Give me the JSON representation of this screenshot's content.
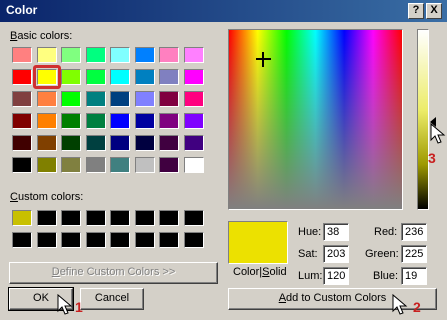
{
  "window": {
    "title": "Color",
    "help_label": "?",
    "close_label": "X"
  },
  "basic_colors": {
    "label_prefix": "B",
    "label_rest": "asic colors:",
    "rows": [
      [
        "#ff8080",
        "#ffff80",
        "#80ff80",
        "#00ff80",
        "#80ffff",
        "#0080ff",
        "#ff80c0",
        "#ff80ff"
      ],
      [
        "#ff0000",
        "#ffff00",
        "#80ff00",
        "#00ff40",
        "#00ffff",
        "#0080c0",
        "#8080c0",
        "#ff00ff"
      ],
      [
        "#804040",
        "#ff8040",
        "#00ff00",
        "#008080",
        "#004080",
        "#8080ff",
        "#800040",
        "#ff0080"
      ],
      [
        "#800000",
        "#ff8000",
        "#008000",
        "#008040",
        "#0000ff",
        "#0000a0",
        "#800080",
        "#8000ff"
      ],
      [
        "#400000",
        "#804000",
        "#004000",
        "#004040",
        "#000080",
        "#000040",
        "#400040",
        "#400080"
      ],
      [
        "#000000",
        "#808000",
        "#808040",
        "#808080",
        "#408080",
        "#c0c0c0",
        "#400040",
        "#ffffff"
      ]
    ],
    "selected": [
      1,
      1
    ]
  },
  "custom_colors": {
    "label_prefix": "C",
    "label_rest": "ustom colors:",
    "rows": [
      [
        "#c8c000",
        "#000000",
        "#000000",
        "#000000",
        "#000000",
        "#000000",
        "#000000",
        "#000000"
      ],
      [
        "#000000",
        "#000000",
        "#000000",
        "#000000",
        "#000000",
        "#000000",
        "#000000",
        "#000000"
      ]
    ]
  },
  "buttons": {
    "define_prefix": "D",
    "define_rest": "efine Custom Colors >>",
    "ok": "OK",
    "cancel": "Cancel",
    "add_prefix": "A",
    "add_rest": "dd to Custom Colors"
  },
  "preview": {
    "label_a": "Color|",
    "label_s": "S",
    "label_b": "olid",
    "color": "#ece100"
  },
  "values": {
    "hue_label": "Hue:",
    "hue": "38",
    "sat_label": "Sat:",
    "sat": "203",
    "lum_label": "Lum:",
    "lum": "120",
    "red_label": "Red:",
    "red": "236",
    "green_label": "Green:",
    "green": "225",
    "blue_label": "Blue:",
    "blue": "19"
  },
  "luminance": {
    "level": 0.47
  },
  "annotations": {
    "one": "1",
    "two": "2",
    "three": "3",
    "color": "#c82020"
  }
}
